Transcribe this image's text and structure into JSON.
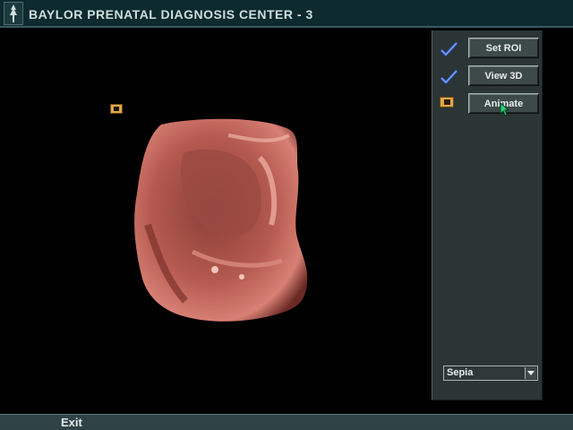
{
  "window": {
    "title": "BAYLOR PRENATAL DIAGNOSIS CENTER - 3"
  },
  "panel": {
    "buttons": [
      {
        "label": "Set ROI",
        "status_icon": "checkmark-icon",
        "checked": true
      },
      {
        "label": "View 3D",
        "status_icon": "checkmark-icon",
        "checked": true
      },
      {
        "label": "Animate",
        "status_icon": "animate-icon",
        "active": true
      }
    ],
    "palette_select": {
      "value": "Sepia"
    }
  },
  "footer": {
    "exit_label": "Exit"
  },
  "colors": {
    "titlebar_bg": "#0d2a2e",
    "panel_bg": "#2b3535",
    "check_blue": "#2f5cd6",
    "marker_orange": "#e0a64a",
    "render_sepia": "#b55a50"
  }
}
